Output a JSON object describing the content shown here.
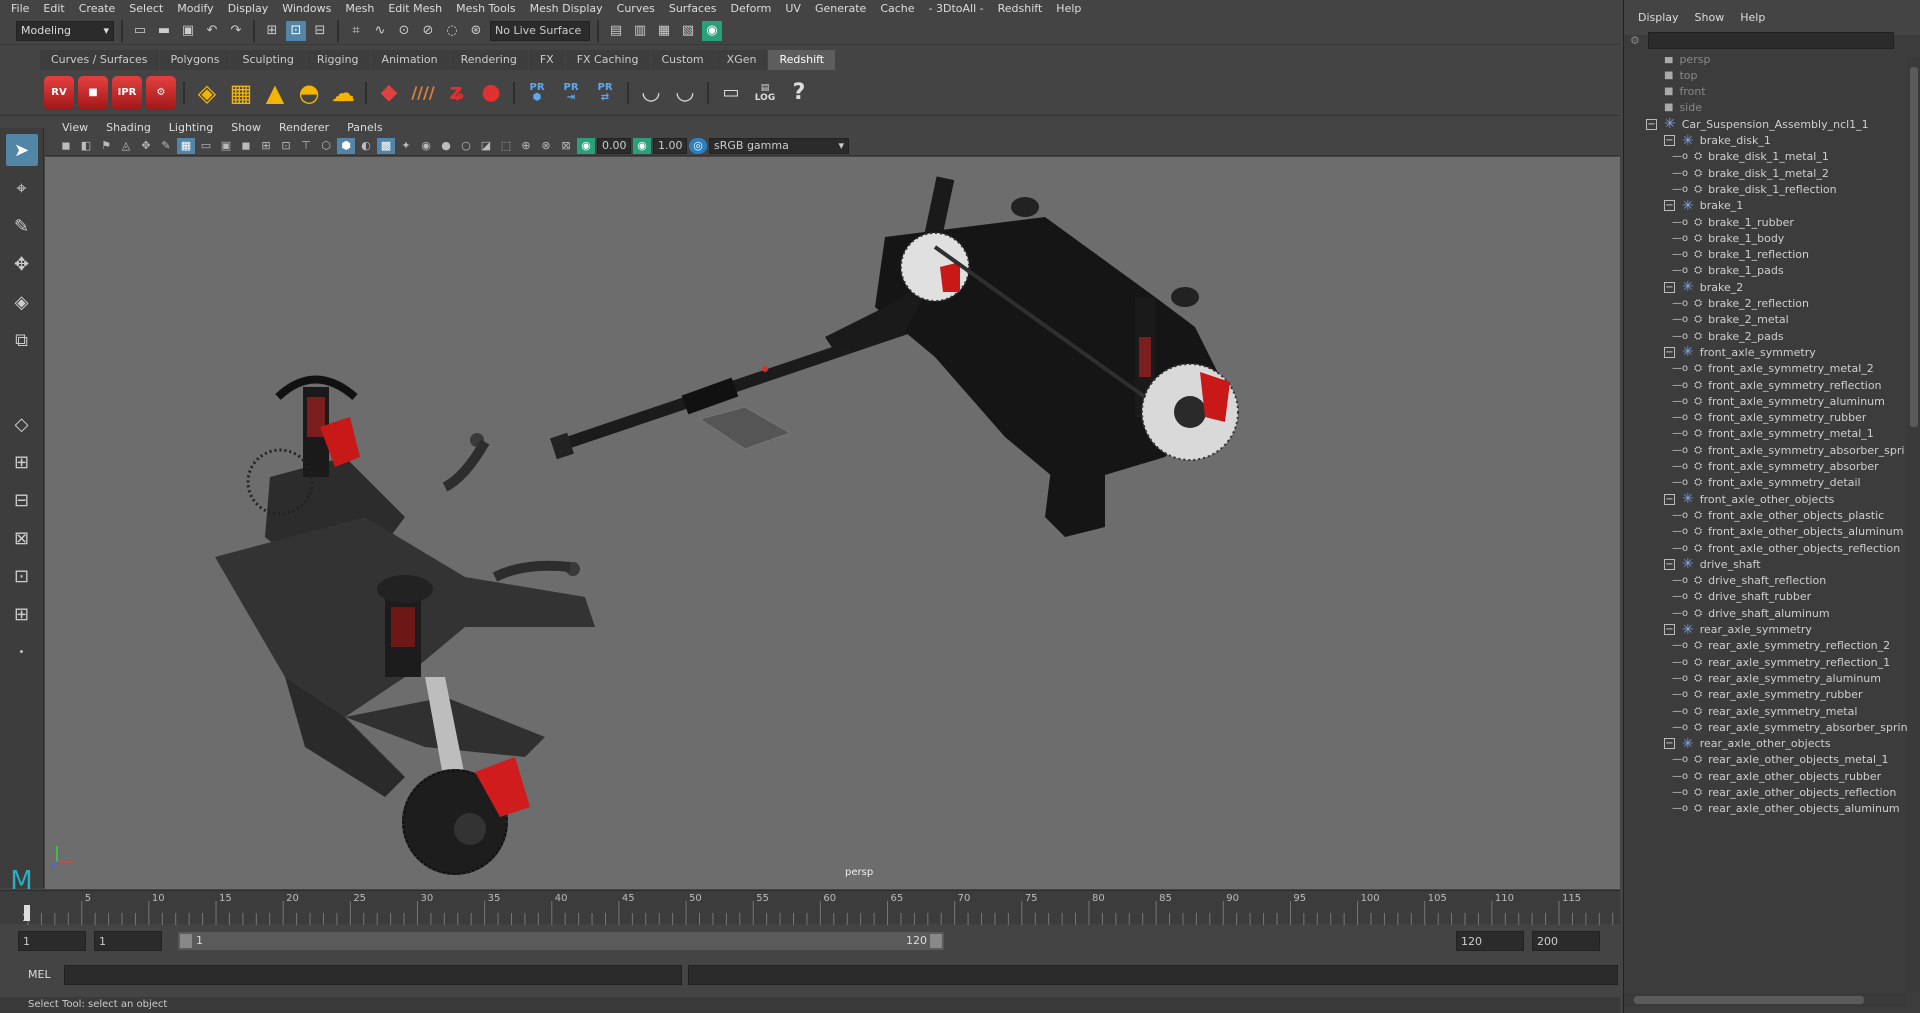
{
  "menu": [
    "File",
    "Edit",
    "Create",
    "Select",
    "Modify",
    "Display",
    "Windows",
    "Mesh",
    "Edit Mesh",
    "Mesh Tools",
    "Mesh Display",
    "Curves",
    "Surfaces",
    "Deform",
    "UV",
    "Generate",
    "Cache",
    "- 3DtoAll -",
    "Redshift",
    "Help"
  ],
  "status": {
    "mode": "Modeling",
    "live_surface": "No Live Surface"
  },
  "shelf_tabs": [
    "Curves / Surfaces",
    "Polygons",
    "Sculpting",
    "Rigging",
    "Animation",
    "Rendering",
    "FX",
    "FX Caching",
    "Custom",
    "XGen",
    "Redshift"
  ],
  "active_shelf_tab": "Redshift",
  "shelf_labels": {
    "rv": "RV",
    "ipr": "IPR",
    "pr": "PR",
    "log": "LOG",
    "help": "?"
  },
  "viewport_menu": [
    "View",
    "Shading",
    "Lighting",
    "Show",
    "Renderer",
    "Panels"
  ],
  "viewport_tool": {
    "exposure": "0.00",
    "gamma": "1.00",
    "colorspace": "sRGB gamma"
  },
  "viewport_label": "persp",
  "timeline": {
    "ticks": [
      "5",
      "10",
      "15",
      "20",
      "25",
      "30",
      "35",
      "40",
      "45",
      "50",
      "55",
      "60",
      "65",
      "70",
      "75",
      "80",
      "85",
      "90",
      "95",
      "100",
      "105",
      "110",
      "115"
    ],
    "current": "1"
  },
  "range": {
    "start": "1",
    "play_start": "1",
    "slider_start": "1",
    "slider_end": "120",
    "play_end": "120",
    "end": "200"
  },
  "cmd": {
    "label": "MEL"
  },
  "help_text": "Select Tool: select an object",
  "outliner": {
    "menu": [
      "Display",
      "Show",
      "Help"
    ],
    "cameras": [
      "persp",
      "top",
      "front",
      "side"
    ],
    "root": "Car_Suspension_Assembly_ncl1_1",
    "groups": [
      {
        "name": "brake_disk_1",
        "children": [
          "brake_disk_1_metal_1",
          "brake_disk_1_metal_2",
          "brake_disk_1_reflection"
        ]
      },
      {
        "name": "brake_1",
        "children": [
          "brake_1_rubber",
          "brake_1_body",
          "brake_1_reflection",
          "brake_1_pads"
        ]
      },
      {
        "name": "brake_2",
        "children": [
          "brake_2_reflection",
          "brake_2_metal",
          "brake_2_pads"
        ]
      },
      {
        "name": "front_axle_symmetry",
        "children": [
          "front_axle_symmetry_metal_2",
          "front_axle_symmetry_reflection",
          "front_axle_symmetry_aluminum",
          "front_axle_symmetry_rubber",
          "front_axle_symmetry_metal_1",
          "front_axle_symmetry_absorber_spri",
          "front_axle_symmetry_absorber",
          "front_axle_symmetry_detail"
        ]
      },
      {
        "name": "front_axle_other_objects",
        "children": [
          "front_axle_other_objects_plastic",
          "front_axle_other_objects_aluminum",
          "front_axle_other_objects_reflection"
        ]
      },
      {
        "name": "drive_shaft",
        "children": [
          "drive_shaft_reflection",
          "drive_shaft_rubber",
          "drive_shaft_aluminum"
        ]
      },
      {
        "name": "rear_axle_symmetry",
        "children": [
          "rear_axle_symmetry_reflection_2",
          "rear_axle_symmetry_reflection_1",
          "rear_axle_symmetry_aluminum",
          "rear_axle_symmetry_rubber",
          "rear_axle_symmetry_metal",
          "rear_axle_symmetry_absorber_sprin"
        ]
      },
      {
        "name": "rear_axle_other_objects",
        "children": [
          "rear_axle_other_objects_metal_1",
          "rear_axle_other_objects_rubber",
          "rear_axle_other_objects_reflection",
          "rear_axle_other_objects_aluminum"
        ]
      }
    ]
  }
}
